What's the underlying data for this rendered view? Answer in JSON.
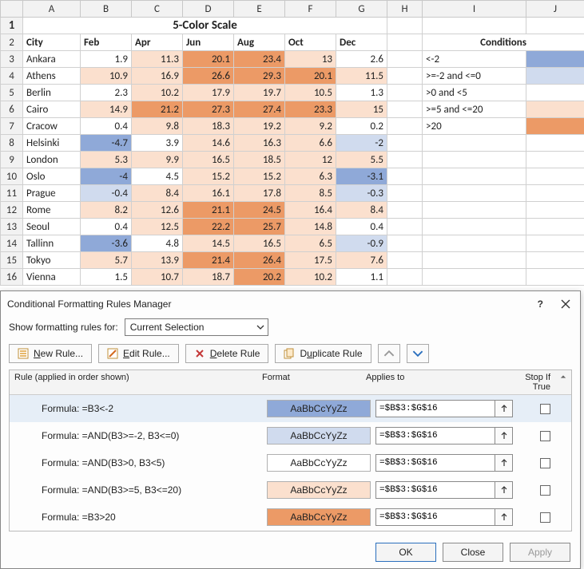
{
  "sheet": {
    "title": "5-Color Scale",
    "cols": [
      "A",
      "B",
      "C",
      "D",
      "E",
      "F",
      "G",
      "H",
      "I",
      "J"
    ],
    "headers": [
      "City",
      "Feb",
      "Apr",
      "Jun",
      "Aug",
      "Oct",
      "Dec"
    ],
    "rows": [
      {
        "r": 3,
        "city": "Ankara",
        "v": [
          1.9,
          11.3,
          20.1,
          23.4,
          13,
          2.6
        ]
      },
      {
        "r": 4,
        "city": "Athens",
        "v": [
          10.9,
          16.9,
          26.6,
          29.3,
          20.1,
          11.5
        ]
      },
      {
        "r": 5,
        "city": "Berlin",
        "v": [
          2.3,
          10.2,
          17.9,
          19.7,
          10.5,
          1.3
        ]
      },
      {
        "r": 6,
        "city": "Cairo",
        "v": [
          14.9,
          21.2,
          27.3,
          27.4,
          23.3,
          15
        ]
      },
      {
        "r": 7,
        "city": "Cracow",
        "v": [
          0.4,
          9.8,
          18.3,
          19.2,
          9.2,
          0.2
        ]
      },
      {
        "r": 8,
        "city": "Helsinki",
        "v": [
          -4.7,
          3.9,
          14.6,
          16.3,
          6.6,
          -2
        ]
      },
      {
        "r": 9,
        "city": "London",
        "v": [
          5.3,
          9.9,
          16.5,
          18.5,
          12,
          5.5
        ]
      },
      {
        "r": 10,
        "city": "Oslo",
        "v": [
          -4,
          4.5,
          15.2,
          15.2,
          6.3,
          -3.1
        ]
      },
      {
        "r": 11,
        "city": "Prague",
        "v": [
          -0.4,
          8.4,
          16.1,
          17.8,
          8.5,
          -0.3
        ]
      },
      {
        "r": 12,
        "city": "Rome",
        "v": [
          8.2,
          12.6,
          21.1,
          24.5,
          16.4,
          8.4
        ]
      },
      {
        "r": 13,
        "city": "Seoul",
        "v": [
          0.4,
          12.5,
          22.2,
          25.7,
          14.8,
          0.4
        ]
      },
      {
        "r": 14,
        "city": "Tallinn",
        "v": [
          -3.6,
          4.8,
          14.5,
          16.5,
          6.5,
          -0.9
        ]
      },
      {
        "r": 15,
        "city": "Tokyo",
        "v": [
          5.7,
          13.9,
          21.4,
          26.4,
          17.5,
          7.6
        ]
      },
      {
        "r": 16,
        "city": "Vienna",
        "v": [
          1.5,
          10.7,
          18.7,
          20.2,
          10.2,
          1.1
        ]
      }
    ],
    "conditions_header": "Conditions",
    "conditions": [
      {
        "label": "<-2",
        "color": "#8fa9d8"
      },
      {
        "label": ">=-2 and <=0",
        "color": "#d0dbee"
      },
      {
        "label": ">0 and <5",
        "color": "#ffffff"
      },
      {
        "label": ">=5 and <=20",
        "color": "#fbe0ce"
      },
      {
        "label": ">20",
        "color": "#ec9a66"
      }
    ]
  },
  "colors": {
    "c1": "#8fa9d8",
    "c2": "#d0dbee",
    "c3": "#ffffff",
    "c4": "#fbe0ce",
    "c5": "#ec9a66"
  },
  "dialog": {
    "title": "Conditional Formatting Rules Manager",
    "show_label": "Show formatting rules for:",
    "show_value": "Current Selection",
    "btn_new": "New Rule...",
    "btn_edit": "Edit Rule...",
    "btn_delete": "Delete Rule",
    "btn_duplicate": "Duplicate Rule",
    "col_rule": "Rule (applied in order shown)",
    "col_format": "Format",
    "col_applies": "Applies to",
    "col_stop": "Stop If True",
    "format_sample": "AaBbCcYyZz",
    "rules": [
      {
        "text": "Formula: =B3<-2",
        "bg": "#8fa9d8",
        "applies": "=$B$3:$G$16",
        "selected": true
      },
      {
        "text": "Formula: =AND(B3>=-2, B3<=0)",
        "bg": "#d0dbee",
        "applies": "=$B$3:$G$16",
        "selected": false
      },
      {
        "text": "Formula: =AND(B3>0, B3<5)",
        "bg": "#ffffff",
        "applies": "=$B$3:$G$16",
        "selected": false
      },
      {
        "text": "Formula: =AND(B3>=5, B3<=20)",
        "bg": "#fbe0ce",
        "applies": "=$B$3:$G$16",
        "selected": false
      },
      {
        "text": "Formula: =B3>20",
        "bg": "#ec9a66",
        "applies": "=$B$3:$G$16",
        "selected": false
      }
    ],
    "ok": "OK",
    "close": "Close",
    "apply": "Apply"
  },
  "chart_data": {
    "type": "table",
    "title": "5-Color Scale",
    "columns": [
      "City",
      "Feb",
      "Apr",
      "Jun",
      "Aug",
      "Oct",
      "Dec"
    ],
    "rows": [
      [
        "Ankara",
        1.9,
        11.3,
        20.1,
        23.4,
        13,
        2.6
      ],
      [
        "Athens",
        10.9,
        16.9,
        26.6,
        29.3,
        20.1,
        11.5
      ],
      [
        "Berlin",
        2.3,
        10.2,
        17.9,
        19.7,
        10.5,
        1.3
      ],
      [
        "Cairo",
        14.9,
        21.2,
        27.3,
        27.4,
        23.3,
        15
      ],
      [
        "Cracow",
        0.4,
        9.8,
        18.3,
        19.2,
        9.2,
        0.2
      ],
      [
        "Helsinki",
        -4.7,
        3.9,
        14.6,
        16.3,
        6.6,
        -2
      ],
      [
        "London",
        5.3,
        9.9,
        16.5,
        18.5,
        12,
        5.5
      ],
      [
        "Oslo",
        -4,
        4.5,
        15.2,
        15.2,
        6.3,
        -3.1
      ],
      [
        "Prague",
        -0.4,
        8.4,
        16.1,
        17.8,
        8.5,
        -0.3
      ],
      [
        "Rome",
        8.2,
        12.6,
        21.1,
        24.5,
        16.4,
        8.4
      ],
      [
        "Seoul",
        0.4,
        12.5,
        22.2,
        25.7,
        14.8,
        0.4
      ],
      [
        "Tallinn",
        -3.6,
        4.8,
        14.5,
        16.5,
        6.5,
        -0.9
      ],
      [
        "Tokyo",
        5.7,
        13.9,
        21.4,
        26.4,
        17.5,
        7.6
      ],
      [
        "Vienna",
        1.5,
        10.7,
        18.7,
        20.2,
        10.2,
        1.1
      ]
    ],
    "color_rules": [
      {
        "rule": "x < -2",
        "color": "#8fa9d8"
      },
      {
        "rule": "-2 <= x <= 0",
        "color": "#d0dbee"
      },
      {
        "rule": "0 < x < 5",
        "color": "#ffffff"
      },
      {
        "rule": "5 <= x <= 20",
        "color": "#fbe0ce"
      },
      {
        "rule": "x > 20",
        "color": "#ec9a66"
      }
    ]
  }
}
